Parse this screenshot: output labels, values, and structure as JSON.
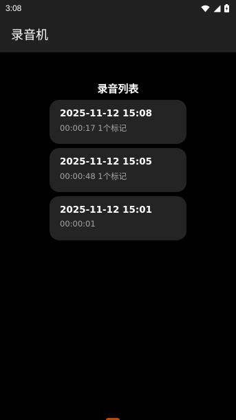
{
  "status_bar": {
    "time": "3:08",
    "icons": [
      "wifi-icon",
      "cell-signal-icon",
      "battery-charging-icon"
    ]
  },
  "app_bar": {
    "title": "录音机"
  },
  "list": {
    "heading": "录音列表",
    "recordings": [
      {
        "date": "2025-11-12 15:08",
        "meta": "00:00:17 1个标记"
      },
      {
        "date": "2025-11-12 15:05",
        "meta": "00:00:48 1个标记"
      },
      {
        "date": "2025-11-12 15:01",
        "meta": "00:00:01"
      }
    ]
  },
  "colors": {
    "background": "#000000",
    "app_bar": "#202020",
    "card": "#242424",
    "secondary_text": "#a6a6a6",
    "accent_peek": "#b44a10"
  }
}
